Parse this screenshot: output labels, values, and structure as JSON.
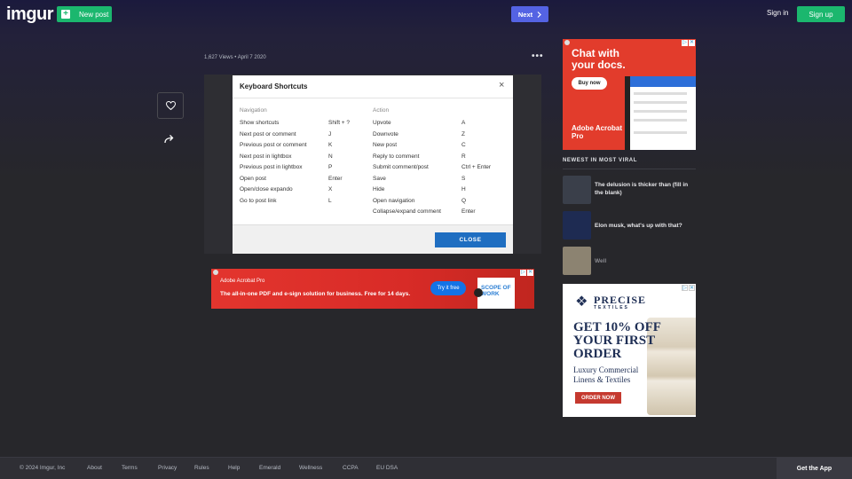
{
  "header": {
    "logo": "imgur",
    "new_post_label": "New post",
    "next_label": "Next",
    "sign_in_label": "Sign in",
    "sign_up_label": "Sign up"
  },
  "post": {
    "views": "1,627 Views",
    "separator": "•",
    "date": "April 7 2020",
    "more_label": "•••"
  },
  "shortcuts_dialog": {
    "title": "Keyboard Shortcuts",
    "close_icon": "×",
    "navigation_header": "Navigation",
    "action_header": "Action",
    "navigation": [
      {
        "label": "Show shortcuts",
        "key": "Shift + ?"
      },
      {
        "label": "Next post or comment",
        "key": "J"
      },
      {
        "label": "Previous post or comment",
        "key": "K"
      },
      {
        "label": "Next post in lightbox",
        "key": "N"
      },
      {
        "label": "Previous post in lightbox",
        "key": "P"
      },
      {
        "label": "Open post",
        "key": "Enter"
      },
      {
        "label": "Open/close expando",
        "key": "X"
      },
      {
        "label": "Go to post link",
        "key": "L"
      }
    ],
    "actions": [
      {
        "label": "Upvote",
        "key": "A"
      },
      {
        "label": "Downvote",
        "key": "Z"
      },
      {
        "label": "New post",
        "key": "C"
      },
      {
        "label": "Reply to comment",
        "key": "R"
      },
      {
        "label": "Submit comment/post",
        "key": "Ctrl + Enter"
      },
      {
        "label": "Save",
        "key": "S"
      },
      {
        "label": "Hide",
        "key": "H"
      },
      {
        "label": "Open navigation",
        "key": "Q"
      },
      {
        "label": "Collapse/expand comment",
        "key": "Enter"
      }
    ],
    "close_button": "CLOSE"
  },
  "banner_ad": {
    "brand": "Adobe Acrobat Pro",
    "tagline": "The all-in-one PDF and e-sign solution for business. Free for 14 days.",
    "cta": "Try it free",
    "doc_text": "SCOPE OF WORK",
    "adchoice_label": "▷",
    "close_label": "✕"
  },
  "side_ad": {
    "headline": "Chat with your docs.",
    "cta": "Buy now",
    "product": "Adobe Acrobat Pro",
    "adchoice_label": "▷",
    "close_label": "✕"
  },
  "viral": {
    "header": "NEWEST IN MOST VIRAL",
    "items": [
      {
        "title": "The delusion is thicker than (fill in the blank)",
        "thumb_color": "#3a3f4a"
      },
      {
        "title": "Elon musk, what's up with that?",
        "thumb_color": "#1e2b52"
      },
      {
        "title": "Well",
        "thumb_color": "#8c8371"
      }
    ]
  },
  "ad2": {
    "brand": "PRECISE",
    "brand_sub": "TEXTILES",
    "offer": "GET 10% OFF YOUR FIRST ORDER",
    "sub": "Luxury Commercial Linens & Textiles",
    "cta": "ORDER NOW",
    "adchoice_label": "▷",
    "close_label": "✕"
  },
  "footer": {
    "copyright": "© 2024 Imgur, Inc",
    "links": [
      "About",
      "Terms",
      "Privacy",
      "Rules",
      "Help",
      "Emerald",
      "Wellness",
      "CCPA",
      "EU DSA"
    ],
    "get_app": "Get the App"
  },
  "colors": {
    "brand_green": "#1bb76e",
    "next_blue": "#5463e3",
    "close_blue": "#1f6ec1",
    "acrobat_red": "#e23c2c"
  }
}
